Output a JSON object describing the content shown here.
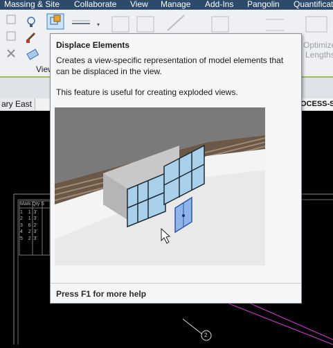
{
  "menu": {
    "items": [
      "Massing & Site",
      "Collaborate",
      "View",
      "Manage",
      "Add-Ins",
      "Pangolin",
      "Quantificati"
    ]
  },
  "ribbon": {
    "panel_label": "View",
    "optimize_label_1": "Optimize",
    "optimize_label_2": "Lengths"
  },
  "tabs": {
    "left_tab": "ary East 1",
    "right_tab": "OCESS-S"
  },
  "tooltip": {
    "title": "Displace Elements",
    "description": "Creates a view-specific representation of model elements that can be displaced in the view.",
    "note": "This feature is useful for creating exploded views.",
    "help": "Press F1 for more help"
  },
  "schedule": {
    "headers": [
      "Mark",
      "Qty",
      "S"
    ],
    "rows": [
      [
        "1",
        "1",
        "3'"
      ],
      [
        "2",
        "1",
        "3'"
      ],
      [
        "3",
        "6",
        "2'"
      ],
      [
        "4",
        "2",
        "3'"
      ],
      [
        "5",
        "2",
        "3'"
      ]
    ]
  },
  "grid_tag": "2",
  "colors": {
    "menubar": "#2e4a6b",
    "ribbon_accent": "#9dc04a",
    "grid_line": "#cc33cc"
  }
}
